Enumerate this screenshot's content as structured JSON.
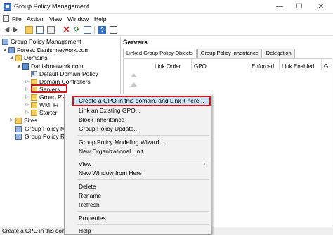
{
  "window": {
    "title": "Group Policy Management",
    "controls": {
      "minimize": "—",
      "maximize": "☐",
      "close": "✕"
    }
  },
  "menubar": {
    "items": [
      "File",
      "Action",
      "View",
      "Window",
      "Help"
    ]
  },
  "toolbar": {
    "icons": [
      "back-arrow-icon",
      "forward-arrow-icon",
      "folder-up-icon",
      "show-hide-tree-icon",
      "copy-icon",
      "delete-icon",
      "refresh-icon",
      "export-list-icon",
      "help-icon",
      "properties-icon"
    ]
  },
  "tree": {
    "root": "Group Policy Management",
    "forest": "Forest: Danishnetwork.com",
    "domains": "Domains",
    "domain": "Danishnetwork.com",
    "default_policy": "Default Domain Policy",
    "domain_controllers": "Domain Controllers",
    "servers": "Servers",
    "group": "Group P",
    "wmi": "WMI Fi",
    "starter": "Starter",
    "sites": "Sites",
    "modeling": "Group Policy M",
    "results": "Group Policy R"
  },
  "right_pane": {
    "title": "Servers",
    "tabs": [
      "Linked Group Policy Objects",
      "Group Policy Inheritance",
      "Delegation"
    ],
    "columns": [
      "Link Order",
      "GPO",
      "Enforced",
      "Link Enabled",
      "G"
    ]
  },
  "context_menu": {
    "items": [
      "Create a GPO in this domain, and Link it here...",
      "Link an Existing GPO...",
      "Block Inheritance",
      "Group Policy Update...",
      "Group Policy Modeling Wizard...",
      "New Organizational Unit",
      "View",
      "New Window from Here",
      "Delete",
      "Rename",
      "Refresh",
      "Properties",
      "Help"
    ],
    "submenu_arrow": "›"
  },
  "status": {
    "text": "Create a GPO in this domai"
  },
  "colors": {
    "highlight_border": "#d0181f",
    "menu_hover": "#cce4f7"
  }
}
